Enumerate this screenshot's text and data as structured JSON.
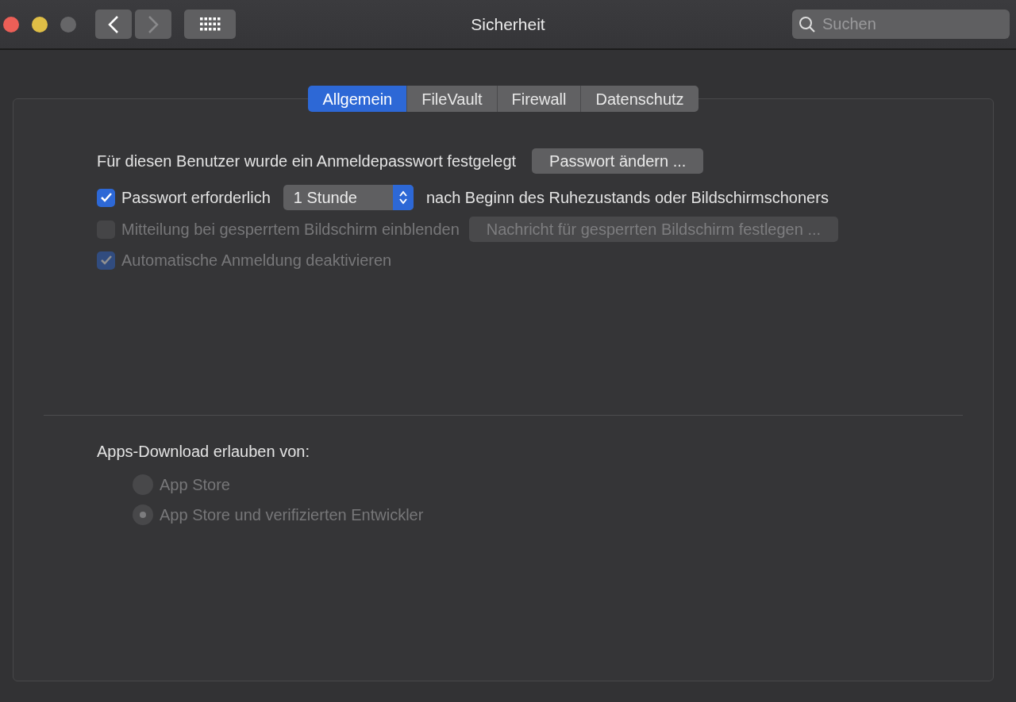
{
  "window": {
    "title": "Sicherheit"
  },
  "search": {
    "placeholder": "Suchen"
  },
  "tabs": [
    {
      "label": "Allgemein",
      "selected": true
    },
    {
      "label": "FileVault",
      "selected": false
    },
    {
      "label": "Firewall",
      "selected": false
    },
    {
      "label": "Datenschutz",
      "selected": false
    }
  ],
  "password": {
    "label": "Für diesen Benutzer wurde ein Anmeldepasswort festgelegt",
    "button": "Passwort ändern ..."
  },
  "options": [
    {
      "kind": "select",
      "label": "Passwort erforderlich",
      "checked": true,
      "disabled": false,
      "value": "1 Stunde",
      "suffix": "nach Beginn des Ruhezustands oder Bildschirmschoners"
    },
    {
      "kind": "button",
      "label": "Mitteilung bei gesperrtem Bildschirm einblenden",
      "checked": false,
      "disabled": true,
      "button": "Nachricht für gesperrten Bildschirm festlegen ..."
    },
    {
      "kind": "plain",
      "label": "Automatische Anmeldung deaktivieren",
      "checked": true,
      "disabled": true
    }
  ],
  "downloads": {
    "heading": "Apps-Download erlauben von:",
    "disabled": true,
    "choices": [
      {
        "label": "App Store",
        "selected": false
      },
      {
        "label": "App Store und verifizierten Entwickler",
        "selected": true
      }
    ]
  }
}
